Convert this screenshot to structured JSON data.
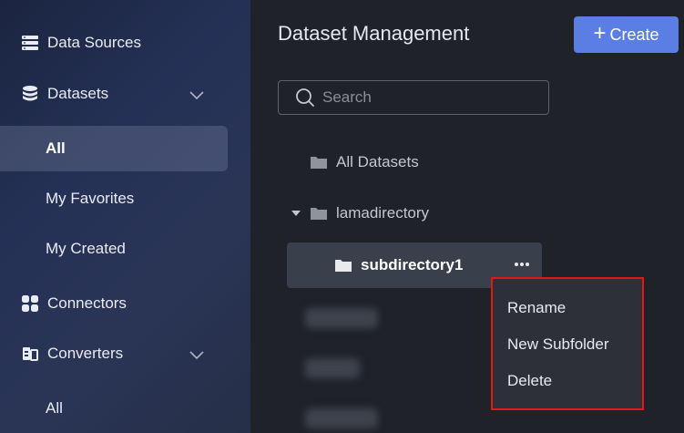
{
  "sidebar": {
    "items": [
      {
        "label": "Data Sources",
        "icon": "database-list-icon"
      },
      {
        "label": "Datasets",
        "icon": "dataset-stack-icon"
      },
      {
        "label": "All"
      },
      {
        "label": "My Favorites"
      },
      {
        "label": "My Created"
      },
      {
        "label": "Connectors",
        "icon": "connector-grid-icon"
      },
      {
        "label": "Converters",
        "icon": "converter-icon"
      },
      {
        "label": "All"
      }
    ]
  },
  "main": {
    "title": "Dataset Management",
    "create_label": "Create",
    "search_placeholder": "Search",
    "tree": [
      {
        "label": "All Datasets"
      },
      {
        "label": "lamadirectory"
      },
      {
        "label": "subdirectory1"
      }
    ]
  },
  "context_menu": {
    "items": [
      "Rename",
      "New Subfolder",
      "Delete"
    ]
  },
  "colors": {
    "accent": "#5b7ee4",
    "highlight_border": "#e01818"
  }
}
